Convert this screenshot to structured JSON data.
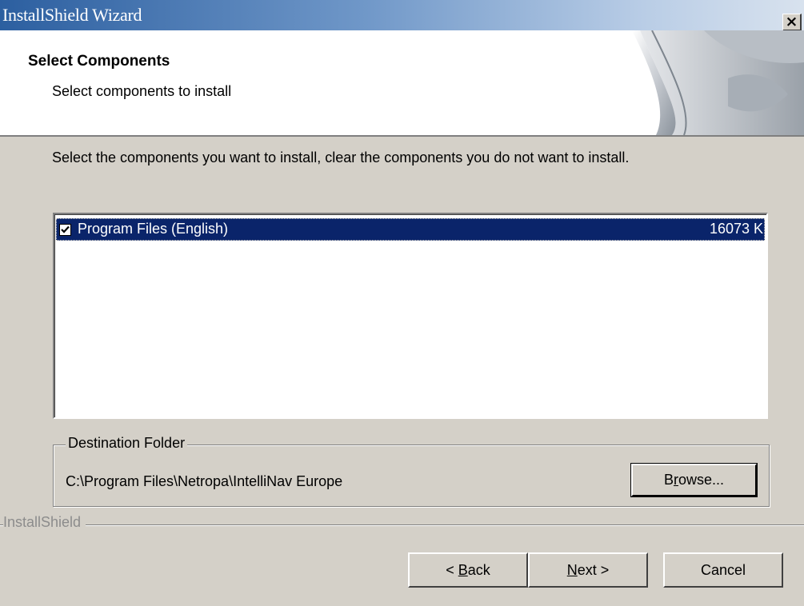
{
  "window": {
    "title": "InstallShield Wizard",
    "close_glyph": "×"
  },
  "header": {
    "title": "Select Components",
    "subtitle": "Select components to install"
  },
  "instructions": "Select the components you want to install, clear the components you do not want to install.",
  "components": [
    {
      "label": "Program Files (English)",
      "size": "16073 K",
      "checked": true,
      "selected": true
    }
  ],
  "destination": {
    "legend": "Destination Folder",
    "path": "C:\\Program Files\\Netropa\\IntelliNav Europe",
    "browse_pre": "B",
    "browse_u": "r",
    "browse_post": "owse..."
  },
  "brand_label": "InstallShield",
  "buttons": {
    "back_pre": "< ",
    "back_u": "B",
    "back_post": "ack",
    "next_u": "N",
    "next_post": "ext >",
    "cancel": "Cancel"
  },
  "colors": {
    "selection": "#0a246a",
    "face": "#d4d0c8"
  },
  "icons": {
    "close": "close-icon",
    "checkbox": "checkmark-icon",
    "banner": "installshield-banner-art"
  }
}
